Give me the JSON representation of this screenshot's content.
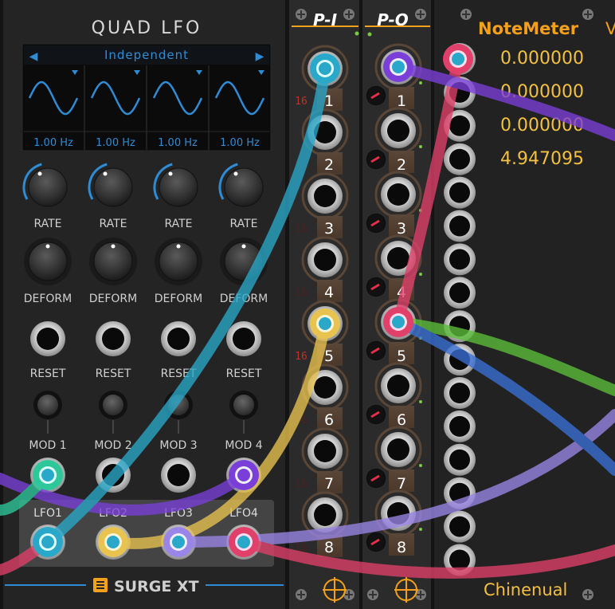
{
  "quad_lfo": {
    "title": "QUAD LFO",
    "mode": "Independent",
    "mode_prev_label": "◀",
    "mode_next_label": "▶",
    "frequencies": [
      "1.00 Hz",
      "1.00 Hz",
      "1.00 Hz",
      "1.00 Hz"
    ],
    "rate_labels": [
      "RATE",
      "RATE",
      "RATE",
      "RATE"
    ],
    "deform_labels": [
      "DEFORM",
      "DEFORM",
      "DEFORM",
      "DEFORM"
    ],
    "reset_labels": [
      "RESET",
      "RESET",
      "RESET",
      "RESET"
    ],
    "mod_labels": [
      "MOD 1",
      "MOD 2",
      "MOD 3",
      "MOD 4"
    ],
    "lfo_labels": [
      "LFO1",
      "LFO2",
      "LFO3",
      "LFO4"
    ],
    "brand": "SURGE XT"
  },
  "poly_in": {
    "title": "P-I",
    "channels": [
      "1",
      "2",
      "3",
      "4",
      "5",
      "6",
      "7",
      "8"
    ],
    "channel_display": "16"
  },
  "poly_out": {
    "title": "P-O",
    "channels": [
      "1",
      "2",
      "3",
      "4",
      "5",
      "6",
      "7",
      "8"
    ]
  },
  "note_meter": {
    "title": "NoteMeter",
    "title_suffix": "V",
    "values": [
      "0.000000",
      "0.000000",
      "0.000000",
      "4.947095"
    ],
    "footer": "Chinenual"
  },
  "colors": {
    "lfo_panel": "#232323",
    "poly_panel": "#2a2a2a",
    "accent_blue": "#2e8bd4",
    "accent_orange": "#f4a01a",
    "cable_teal": "#2aa8c9",
    "cable_purple": "#7b3fd9",
    "cable_pink": "#e0406a",
    "cable_yellow": "#e9c350",
    "cable_green": "#5cbf3a",
    "cable_blue": "#3a6fd6",
    "cable_lavender": "#9a86e6",
    "cable_mint": "#2ec79a"
  }
}
